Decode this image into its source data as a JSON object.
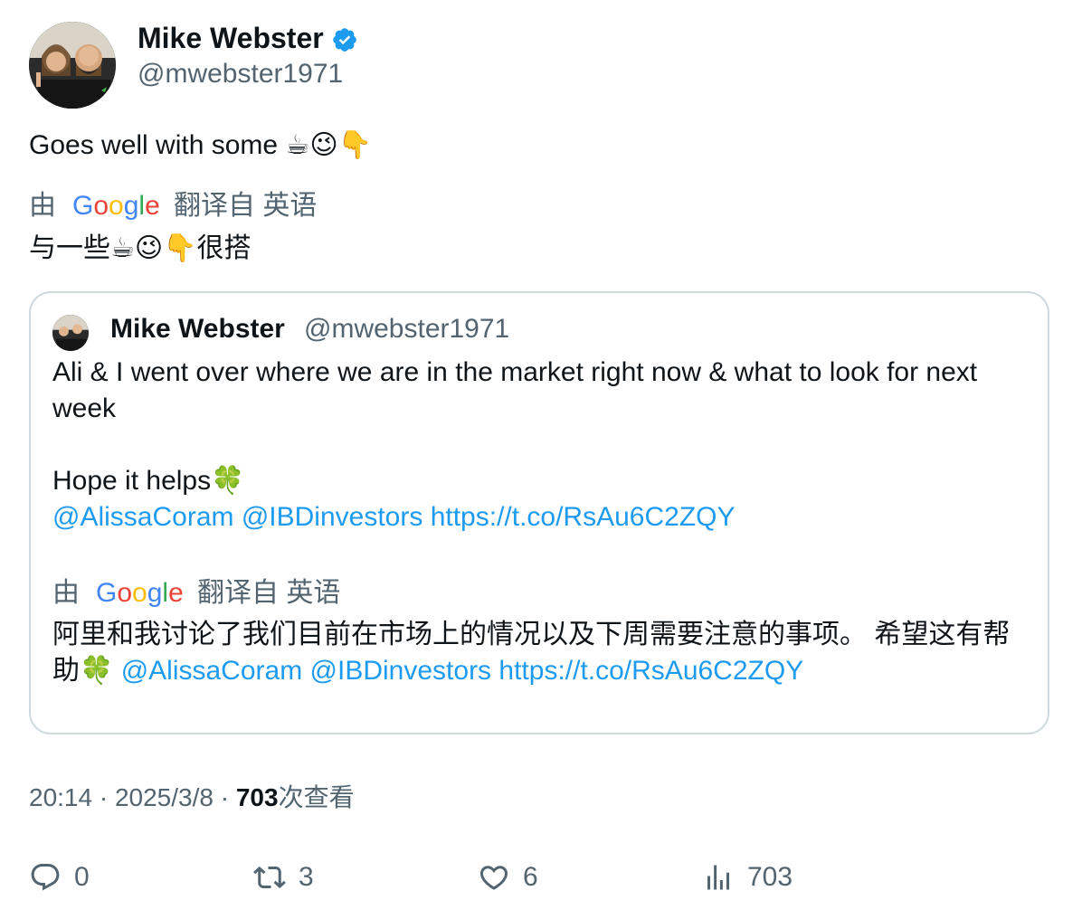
{
  "author": {
    "name": "Mike Webster",
    "handle": "@mwebster1971",
    "verified": true,
    "verified_color": "#1d9bf0"
  },
  "tweet": {
    "text": "Goes well with some",
    "emojis": "☕😉👇",
    "translation_prefix": "由",
    "translation_suffix": "翻译自 英语",
    "translation_text": "与一些☕😉👇很搭"
  },
  "quoted": {
    "name": "Mike Webster",
    "handle": "@mwebster1971",
    "line1": "Ali & I went over where we are in the market right now & what to look for next week",
    "line2": "Hope it helps🍀",
    "mention1": "@AlissaCoram",
    "mention2": "@IBDinvestors",
    "url": "https://t.co/RsAu6C2ZQY",
    "translation_prefix": "由",
    "translation_suffix": "翻译自 英语",
    "translation_text": "阿里和我讨论了我们目前在市场上的情况以及下周需要注意的事项。 希望这有帮助🍀",
    "link_color": "#1d9bf0"
  },
  "meta": {
    "time": "20:14",
    "date": "2025/3/8",
    "views_count": "703",
    "views_label": "次查看"
  },
  "actions": {
    "replies": "0",
    "retweets": "3",
    "likes": "6",
    "views": "703"
  }
}
